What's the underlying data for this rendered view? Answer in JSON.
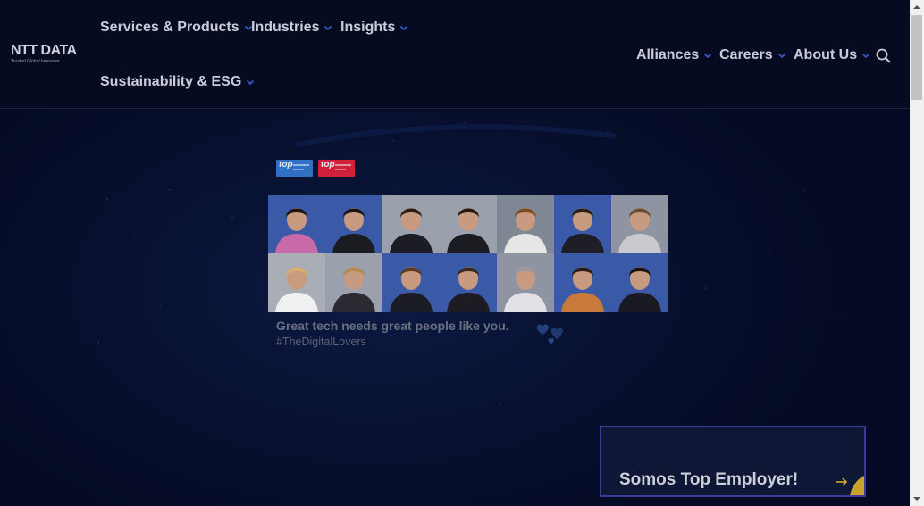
{
  "brand": {
    "name": "NTT DATA",
    "tagline": "Trusted Global Innovator"
  },
  "nav": {
    "left": [
      {
        "label": "Services & Products"
      },
      {
        "label": "Industries"
      },
      {
        "label": "Insights"
      },
      {
        "label": "Sustainability & ESG"
      }
    ],
    "right": [
      {
        "label": "Alliances"
      },
      {
        "label": "Careers"
      },
      {
        "label": "About Us"
      }
    ],
    "search_icon": "search-icon",
    "chevron_icon": "chevron-down-icon"
  },
  "hero": {
    "badges": [
      {
        "text": "top",
        "color": "#2f6fc4"
      },
      {
        "text": "top",
        "color": "#d0213a"
      }
    ],
    "tagline": "Great tech needs great people like you.",
    "hashtag": "#TheDigitalLovers",
    "hearts_icon": "hearts-icon"
  },
  "promo": {
    "title": "Somos Top Employer!",
    "arrow_icon": "arrow-right-icon"
  },
  "colors": {
    "background": "#050a21",
    "accent": "#3f3a9a",
    "chevron": "#3b5cc8",
    "promo_corner": "#c9a227"
  }
}
